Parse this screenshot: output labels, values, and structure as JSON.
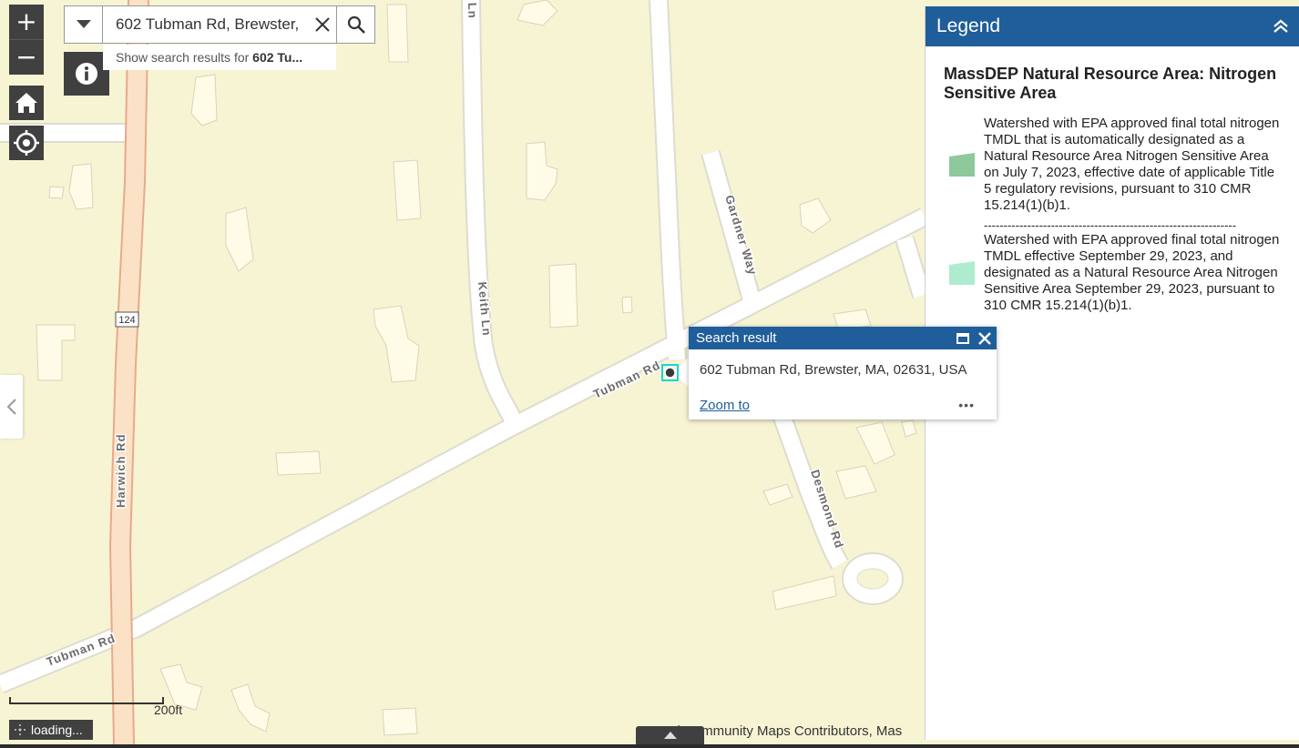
{
  "search": {
    "value": "602 Tubman Rd, Brewster, MA, 02631, USA",
    "suggestion_prefix": "Show search results for ",
    "suggestion_term": "602 Tu..."
  },
  "zoom": {
    "in_label": "+",
    "out_label": "−"
  },
  "map": {
    "route_shield": "124",
    "street_labels": {
      "harwich": "Harwich Rd",
      "keith": "Keith Ln",
      "keith_top": "Ln",
      "tubman_upper": "Tubman Rd",
      "tubman_lower": "Tubman Rd",
      "gardner": "Gardner Way",
      "desmond": "Desmond Rd"
    },
    "scale_label": "200ft",
    "loading_label": "loading...",
    "attribution": "Esri Community Maps Contributors, Mas",
    "colors": {
      "land": "#f7f4d4",
      "road": "#ffffff",
      "road_edge": "#d8d6c8",
      "highway": "#fbe2c6",
      "highway_edge": "#e9a98c",
      "building": "#fefce6",
      "marker": "#3a3a3a",
      "marker_highlight": "#19d3dd"
    }
  },
  "legend": {
    "title": "Legend",
    "layer_title": "MassDEP Natural Resource Area: Nitrogen Sensitive Area",
    "items": [
      {
        "color": "#8fc89a",
        "label": "Watershed with EPA approved final total nitrogen TMDL that is automatically designated as a Natural Resource Area Nitrogen Sensitive Area on July 7, 2023, effective date of applicable Title 5 regulatory revisions, pursuant to 310 CMR 15.214(1)(b)1."
      },
      {
        "color": "#aeebcf",
        "label": "Watershed with EPA approved final total nitrogen TMDL effective September 29, 2023, and designated as a Natural Resource Area Nitrogen Sensitive Area September 29, 2023, pursuant to 310 CMR 15.214(1)(b)1."
      }
    ],
    "separator": "----------------------------------------------------------------"
  },
  "popup": {
    "title": "Search result",
    "address": "602 Tubman Rd, Brewster, MA, 02631, USA",
    "zoom_label": "Zoom to",
    "more_label": "•••"
  }
}
